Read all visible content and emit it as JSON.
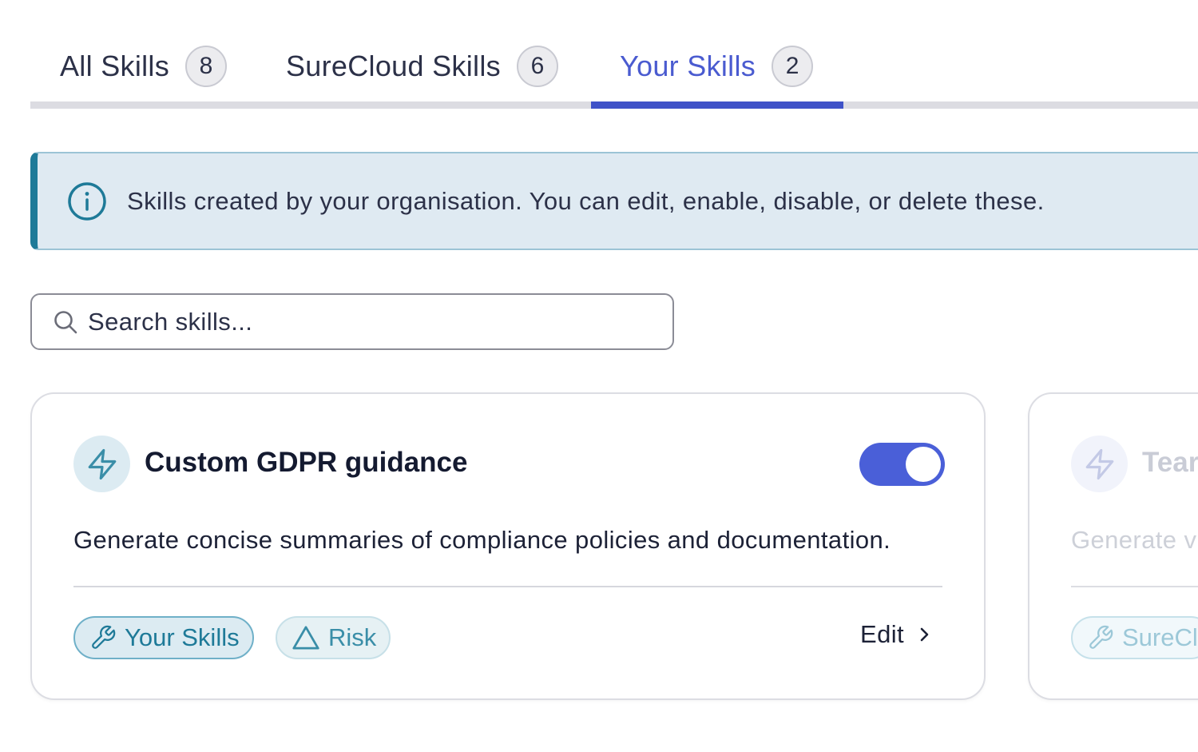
{
  "tabs": [
    {
      "label": "All Skills",
      "count": "8",
      "active": false
    },
    {
      "label": "SureCloud Skills",
      "count": "6",
      "active": false
    },
    {
      "label": "Your Skills",
      "count": "2",
      "active": true
    }
  ],
  "banner": {
    "icon": "info-icon",
    "text": "Skills created by your organisation. You can edit, enable, disable, or delete these."
  },
  "search": {
    "placeholder": "Search skills...",
    "value": "",
    "icon": "search-icon"
  },
  "cards": [
    {
      "icon": "lightning-icon",
      "title": "Custom GDPR guidance",
      "enabled": true,
      "description": "Generate concise summaries of compliance policies and documentation.",
      "tags": [
        {
          "label": "Your Skills",
          "icon": "wrench-icon"
        },
        {
          "label": "Risk",
          "icon": "triangle-icon"
        }
      ],
      "edit_label": "Edit"
    },
    {
      "icon": "lightning-icon",
      "title": "Tear",
      "description": "Generate v",
      "tags": [
        {
          "label": "SureCl",
          "icon": "wrench-icon"
        }
      ]
    }
  ],
  "colors": {
    "accent": "#4a5fd8",
    "active_tab_text": "#4a5bd0",
    "teal": "#1e7a98",
    "banner_bg": "#dfeaf2"
  }
}
